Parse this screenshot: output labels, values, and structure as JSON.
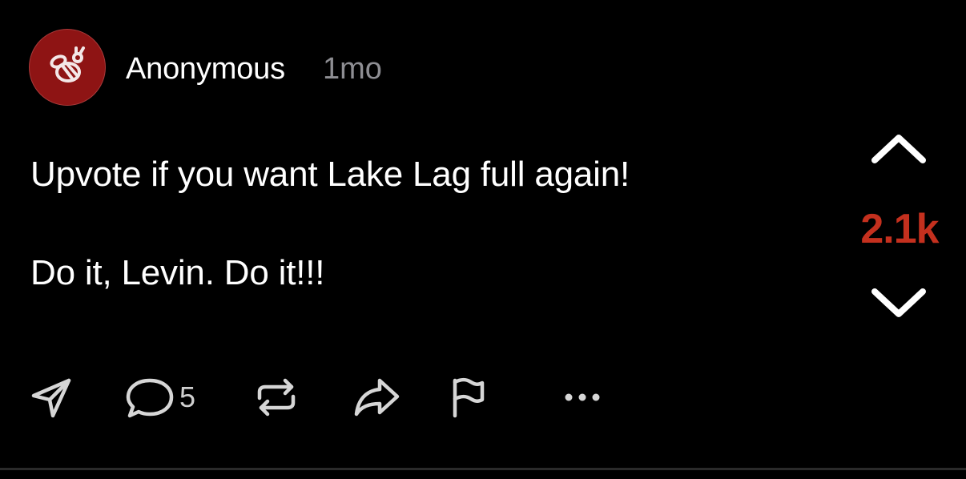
{
  "post": {
    "author": "Anonymous",
    "time_ago": "1mo",
    "lines": [
      "Upvote if you want Lake Lag full again!",
      "Do it, Levin. Do it!!!"
    ]
  },
  "vote": {
    "count": "2.1k",
    "count_color": "#c4301e"
  },
  "actions": {
    "comment_count": "5",
    "icons": [
      "send-icon",
      "comment-icon",
      "repost-icon",
      "share-icon",
      "flag-icon",
      "more-icon"
    ]
  },
  "colors": {
    "background": "#000000",
    "avatar": "#8e1414",
    "muted": "#8e8e93"
  }
}
